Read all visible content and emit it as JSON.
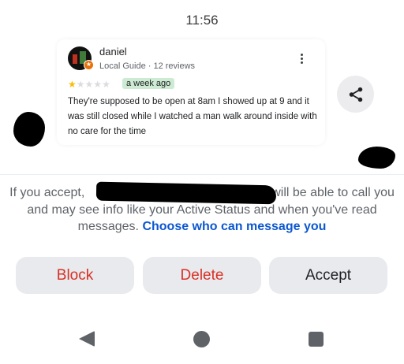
{
  "status_bar": {
    "time": "11:56"
  },
  "review": {
    "reviewer_name": "daniel",
    "reviewer_meta": "Local Guide · 12 reviews",
    "rating": 1,
    "rating_max": 5,
    "star_full": "★",
    "star_empty": "★",
    "time_ago": "a week ago",
    "text": "They're supposed to be open at 8am I showed up at 9 and it was still closed while I watched a man walk around inside with no care for the time",
    "badge_icon": "local-guide-star-icon",
    "menu_icon": "more-vert-icon"
  },
  "share": {
    "icon": "share-icon"
  },
  "message_request": {
    "text_before": "If you accept,",
    "text_after": "will be able to call you and may see info like your Active Status and when you've read messages.",
    "link": "Choose who can message you"
  },
  "actions": {
    "block": "Block",
    "delete": "Delete",
    "accept": "Accept"
  },
  "colors": {
    "danger": "#d93025",
    "link": "#0b57d0",
    "button_bg": "#e8eaed",
    "star": "#fbbc04",
    "chip": "#cdebd3"
  },
  "nav": {
    "back_icon": "back-icon",
    "home_icon": "home-icon",
    "recents_icon": "recents-icon"
  }
}
